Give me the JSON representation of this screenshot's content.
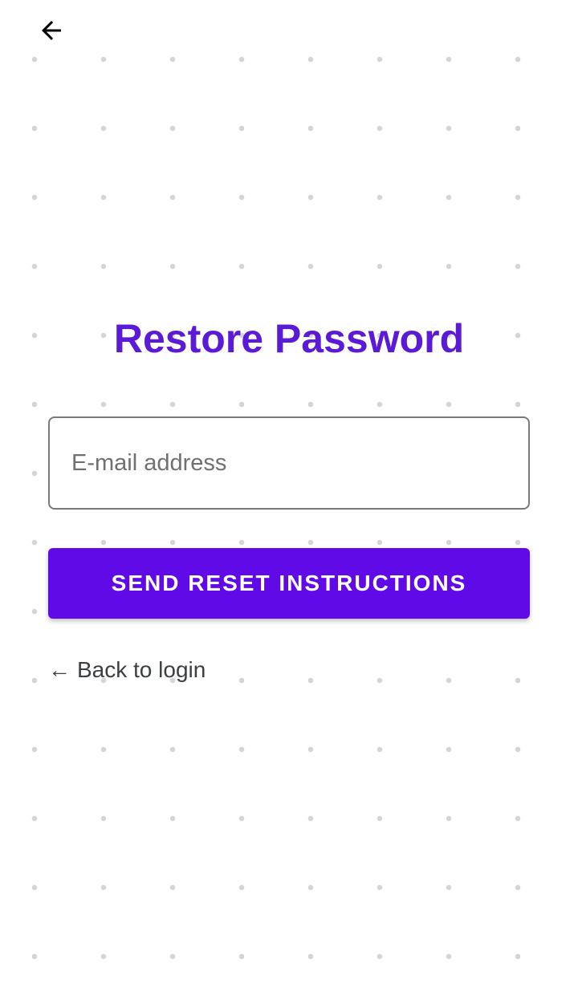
{
  "header": {
    "back_icon": "arrow-left-icon"
  },
  "main": {
    "title": "Restore Password",
    "email_input": {
      "value": "",
      "placeholder": "E-mail address"
    },
    "send_button_label": "SEND RESET INSTRUCTIONS",
    "back_link": {
      "arrow": "←",
      "label": "Back to login"
    }
  },
  "colors": {
    "accent": "#600ae8",
    "title": "#5b1ad6",
    "background": "#ffffff",
    "dots": "#d6d6d6"
  }
}
